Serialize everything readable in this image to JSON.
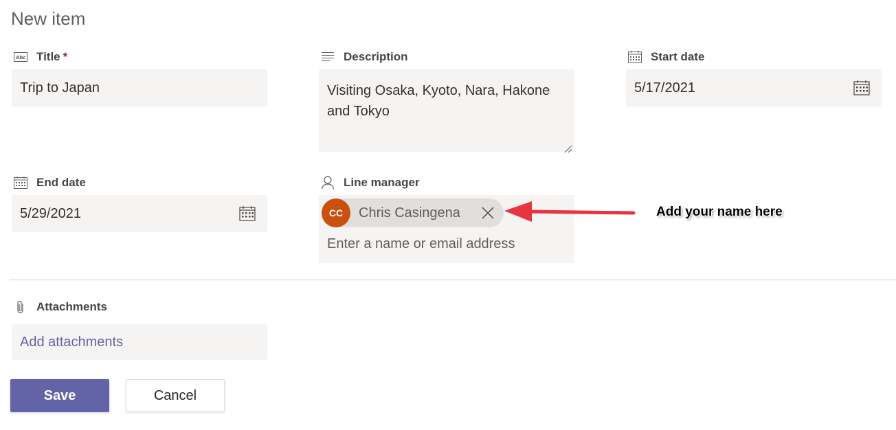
{
  "page": {
    "title": "New item"
  },
  "fields": {
    "title": {
      "label": "Title",
      "required_mark": "*",
      "value": "Trip to Japan"
    },
    "description": {
      "label": "Description",
      "value": "Visiting Osaka, Kyoto, Nara, Hakone and Tokyo"
    },
    "start_date": {
      "label": "Start date",
      "value": "5/17/2021"
    },
    "end_date": {
      "label": "End date",
      "value": "5/29/2021"
    },
    "line_manager": {
      "label": "Line manager",
      "persona": {
        "initials": "CC",
        "name": "Chris Casingena"
      },
      "placeholder": "Enter a name or email address"
    },
    "attachments": {
      "label": "Attachments",
      "link": "Add attachments"
    }
  },
  "buttons": {
    "save": "Save",
    "cancel": "Cancel"
  },
  "annotation": {
    "text": "Add your name here"
  },
  "colors": {
    "accent": "#6264a7",
    "avatar": "#ca5010",
    "required": "#a4262c",
    "arrow": "#e8343e",
    "field_background": "#f5f4f2"
  },
  "icons": {
    "title": "text-field-icon",
    "description": "multiline-text-icon",
    "date": "calendar-icon",
    "person": "person-icon",
    "attachment": "paperclip-icon",
    "remove": "close-icon"
  }
}
